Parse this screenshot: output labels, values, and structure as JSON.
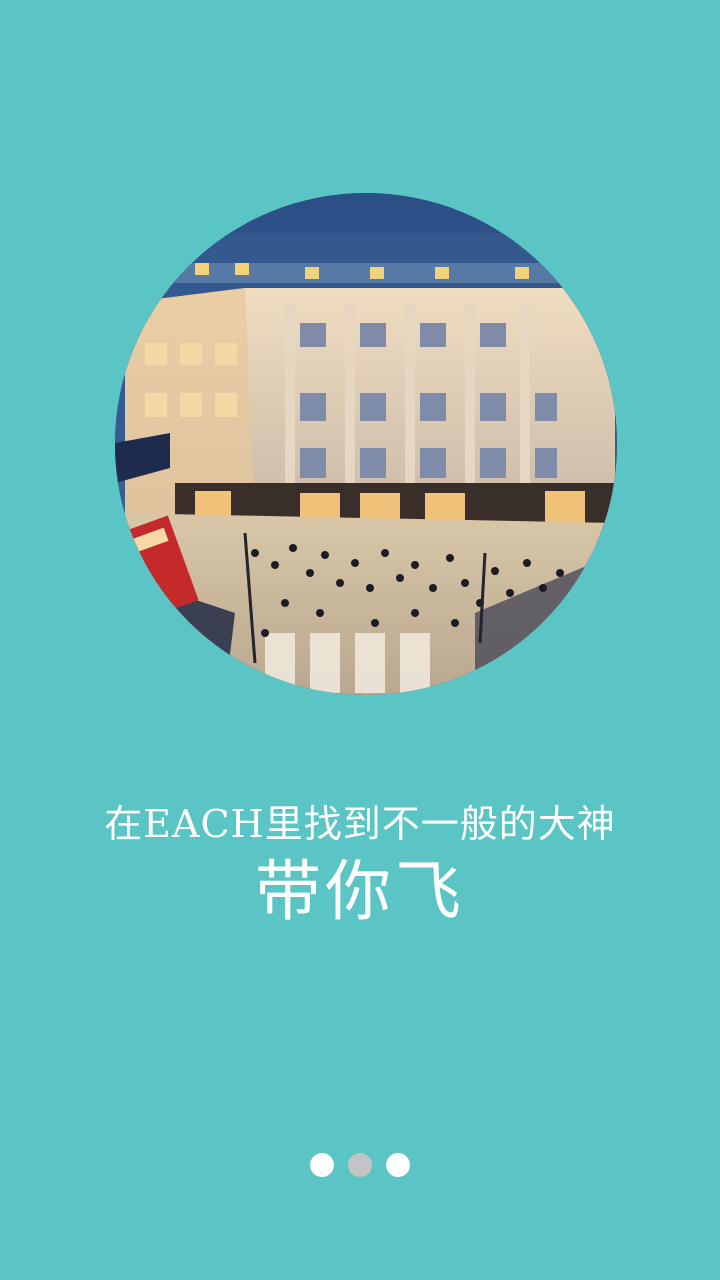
{
  "hero": {
    "image_subject": "tilt-shift aerial view of a city street corner with a department store building, crowds and a red bus"
  },
  "tagline": {
    "line1": "在EACH里找到不一般的大神",
    "line2": "带你飞"
  },
  "pager": {
    "total": 3,
    "current_index": 1
  },
  "colors": {
    "background": "#5bc4c5",
    "text": "#ffffff",
    "dot_inactive": "#ffffff",
    "dot_active": "#c4c4c4"
  }
}
